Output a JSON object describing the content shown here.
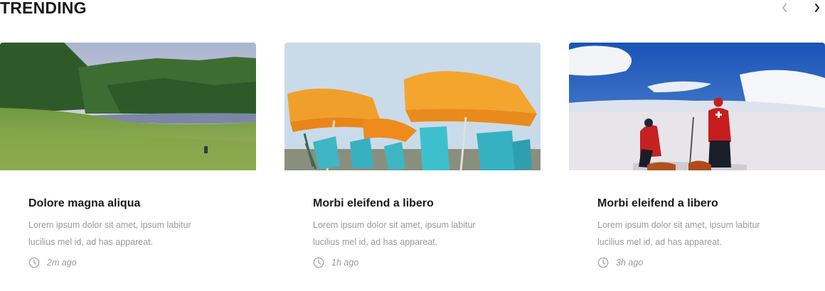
{
  "section": {
    "title": "TRENDING",
    "prev_icon": "chevron-left-icon",
    "next_icon": "chevron-right-icon"
  },
  "cards": [
    {
      "title": "Dolore magna aliqua",
      "excerpt": "Lorem ipsum dolor sit amet, ipsum labitur lucilius mel id, ad has appareat.",
      "time": "2m ago"
    },
    {
      "title": "Morbi eleifend a libero",
      "excerpt": "Lorem ipsum dolor sit amet, ipsum labitur lucilius mel id, ad has appareat.",
      "time": "1h ago"
    },
    {
      "title": "Morbi eleifend a libero",
      "excerpt": "Lorem ipsum dolor sit amet, ipsum labitur lucilius mel id, ad has appareat.",
      "time": "3h ago"
    }
  ],
  "colors": {
    "title": "#1b1b1b",
    "muted": "#9a9a9a",
    "nav_disabled": "#b5b5b5"
  }
}
